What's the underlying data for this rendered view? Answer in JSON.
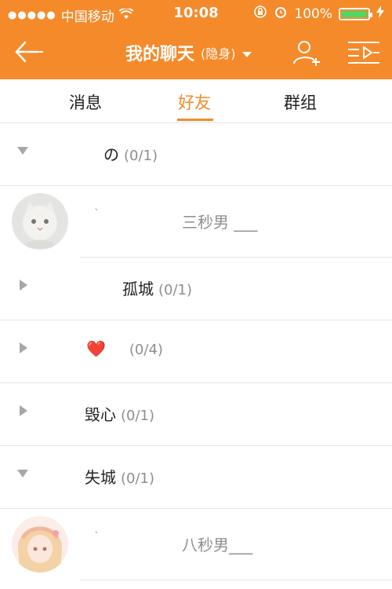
{
  "status_bar": {
    "carrier": "中国移动",
    "time": "10:08",
    "battery": "100%"
  },
  "nav": {
    "title": "我的聊天",
    "subtitle": "(隐身)"
  },
  "tabs": [
    "消息",
    "好友",
    "群组"
  ],
  "groups": [
    {
      "name": "の",
      "count": "(0/1)"
    },
    {
      "name": "孤城",
      "count": "(0/1)"
    },
    {
      "name": "❤️",
      "count": "(0/4)"
    },
    {
      "name": "毁心",
      "count": "(0/1)"
    },
    {
      "name": "失城",
      "count": "(0/1)"
    }
  ],
  "friends": [
    {
      "tick": "ˋ",
      "name": "三秒男 ___"
    },
    {
      "tick": "ˋ",
      "name": "八秒男___"
    }
  ]
}
